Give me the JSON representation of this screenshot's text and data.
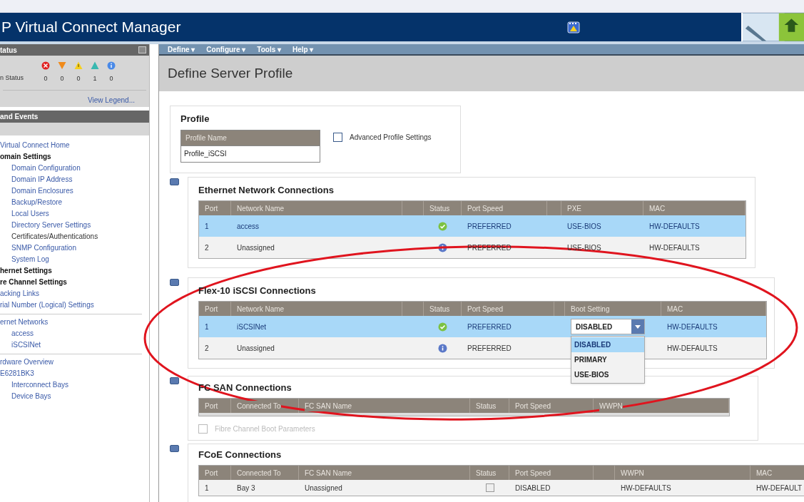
{
  "header": {
    "title": "P Virtual Connect Manager"
  },
  "menu": [
    {
      "label": "Define ▾"
    },
    {
      "label": "Configure ▾"
    },
    {
      "label": "Tools ▾"
    },
    {
      "label": "Help ▾"
    }
  ],
  "sidebar": {
    "status_panel": {
      "title": "tatus",
      "label": "n Status",
      "counts": [
        {
          "kind": "critical",
          "count": "0"
        },
        {
          "kind": "major",
          "count": "0"
        },
        {
          "kind": "warning",
          "count": "0"
        },
        {
          "kind": "minor",
          "count": "1"
        },
        {
          "kind": "info",
          "count": "0"
        }
      ],
      "link": "View Legend..."
    },
    "events_panel": {
      "title": "and Events"
    },
    "nav_groups": [
      [
        {
          "label": "Virtual Connect Home",
          "kind": "link"
        },
        {
          "label": "omain Settings",
          "kind": "heading",
          "children": [
            {
              "label": "Domain Configuration",
              "kind": "link"
            },
            {
              "label": "Domain IP Address",
              "kind": "link"
            },
            {
              "label": "Domain Enclosures",
              "kind": "link"
            },
            {
              "label": "Backup/Restore",
              "kind": "link"
            },
            {
              "label": "Local Users",
              "kind": "link"
            },
            {
              "label": "Directory Server Settings",
              "kind": "link"
            },
            {
              "label": "Certificates/Authentications",
              "kind": "text"
            },
            {
              "label": "SNMP Configuration",
              "kind": "link"
            },
            {
              "label": "System Log",
              "kind": "link"
            }
          ]
        },
        {
          "label": "hernet Settings",
          "kind": "heading"
        },
        {
          "label": "re Channel Settings",
          "kind": "heading"
        },
        {
          "label": "acking Links",
          "kind": "link"
        },
        {
          "label": "rial Number (Logical) Settings",
          "kind": "link"
        }
      ],
      [
        {
          "label": "ernet Networks",
          "kind": "link",
          "children": [
            {
              "label": "access",
              "kind": "link"
            },
            {
              "label": "iSCSINet",
              "kind": "link"
            }
          ]
        }
      ],
      [
        {
          "label": "rdware Overview",
          "kind": "link"
        },
        {
          "label": "E6281BK3",
          "kind": "link",
          "children": [
            {
              "label": "Interconnect Bays",
              "kind": "link"
            },
            {
              "label": "Device Bays",
              "kind": "link"
            }
          ]
        }
      ]
    ]
  },
  "page_title": "Define Server Profile",
  "profile": {
    "title": "Profile",
    "name_label": "Profile Name",
    "name_value": "Profile_iSCSI",
    "advanced": {
      "label": "Advanced Profile Settings",
      "checked": false
    }
  },
  "sections": [
    {
      "title": "Ethernet Network Connections",
      "columns": [
        "Port",
        "Network Name",
        "Status",
        "Port Speed",
        "PXE",
        "MAC"
      ],
      "rows": [
        {
          "selected": true,
          "cells": [
            "1",
            "access",
            {
              "kind": "check"
            },
            "PREFERRED",
            "USE-BIOS",
            "HW-DEFAULTS"
          ]
        },
        {
          "selected": false,
          "cells": [
            "2",
            "Unassigned",
            {
              "kind": "info"
            },
            "PREFERRED",
            "USE-BIOS",
            "HW-DEFAULTS"
          ]
        }
      ]
    },
    {
      "title": "Flex-10 iSCSI Connections",
      "columns": [
        "Port",
        "Network Name",
        "Status",
        "Port Speed",
        "Boot Setting",
        "MAC"
      ],
      "rows": [
        {
          "selected": true,
          "cells": [
            "1",
            "iSCSINet",
            {
              "kind": "check"
            },
            "PREFERRED",
            {
              "kind": "select",
              "value": "DISABLED",
              "expanded": true,
              "options": [
                {
                  "label": "DISABLED",
                  "selected": true
                },
                {
                  "label": "PRIMARY",
                  "selected": false
                },
                {
                  "label": "USE-BIOS",
                  "selected": false
                }
              ]
            },
            "HW-DEFAULTS"
          ]
        },
        {
          "selected": false,
          "cells": [
            "2",
            "Unassigned",
            {
              "kind": "info"
            },
            "PREFERRED",
            null,
            "HW-DEFAULTS"
          ]
        }
      ]
    },
    {
      "title": "FC SAN Connections",
      "columns": [
        "Port",
        "Connected To",
        "FC SAN Name",
        "Status",
        "Port Speed",
        "WWPN"
      ],
      "boot_params": {
        "label": "Fibre Channel Boot Parameters",
        "checked": false,
        "disabled": true
      }
    },
    {
      "title": "FCoE Connections",
      "columns": [
        "Port",
        "Connected To",
        "FC SAN Name",
        "Status",
        "Port Speed",
        "WWPN",
        "MAC"
      ],
      "rows": [
        {
          "selected": false,
          "cells": [
            "1",
            "Bay 3",
            "Unassigned",
            {
              "kind": "checkbox"
            },
            "DISABLED",
            "HW-DEFAULTS",
            "HW-DEFAULT"
          ]
        }
      ]
    }
  ],
  "annotation": {
    "kind": "ellipse"
  }
}
